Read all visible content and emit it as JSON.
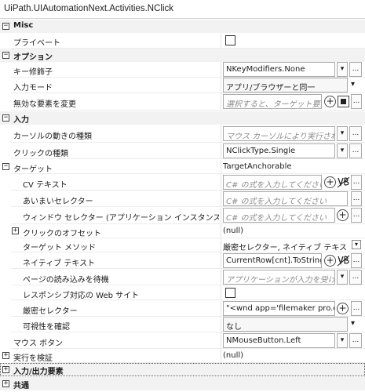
{
  "window": {
    "title": "UiPath.UIAutomationNext.Activities.NClick"
  },
  "categories": {
    "misc": "Misc",
    "options": "オプション",
    "input": "入力",
    "io_elements": "入力/出力要素",
    "common": "共通"
  },
  "expanders": {
    "minus": "⊟",
    "plus": "⊞"
  },
  "properties": {
    "private": {
      "label": "プライベート",
      "checked": false
    },
    "key_modifiers": {
      "label": "キー修飾子",
      "value": "NKeyModifiers.None"
    },
    "input_mode": {
      "label": "入力モード",
      "value": "アプリ/ブラウザーと同一"
    },
    "change_disabled": {
      "label": "無効な要素を変更",
      "value": "選択すると、ターゲット要素が"
    },
    "cursor_motion": {
      "label": "カーソルの動きの種類",
      "value": "マウス カーソルにより実行される動"
    },
    "click_type": {
      "label": "クリックの種類",
      "value": "NClickType.Single"
    },
    "target": {
      "label": "ターゲット",
      "value": "TargetAnchorable"
    },
    "cv_text": {
      "label": "CV テキスト",
      "placeholder": "C# の式を入力してください"
    },
    "fuzzy_selector": {
      "label": "あいまいセレクター",
      "placeholder": "C# の式を入力してください"
    },
    "window_selector": {
      "label": "ウィンドウ セレクター (アプリケーション インスタンス)",
      "placeholder": "C# の式を入力してください"
    },
    "click_offset": {
      "label": "クリックのオフセット",
      "value": "(null)"
    },
    "target_method": {
      "label": "ターゲット メソッド",
      "value": "厳密セレクター, ネイティブ テキスト"
    },
    "native_text": {
      "label": "ネイティブ テキスト",
      "value": "CurrentRow[cnt].ToString()"
    },
    "wait_page_load": {
      "label": "ページの読み込みを待機",
      "value": "アプリケーションが入力を受け入れ"
    },
    "responsive_web": {
      "label": "レスポンシブ対応の Web サイト",
      "checked": false
    },
    "strict_selector": {
      "label": "厳密セレクター",
      "value": "\"<wnd app='filemaker pro.exe"
    },
    "verify_visibility": {
      "label": "可視性を確認",
      "value": "なし"
    },
    "mouse_button": {
      "label": "マウス ボタン",
      "value": "NMouseButton.Left"
    },
    "verify_execution": {
      "label": "実行を検証",
      "value": "(null)"
    }
  },
  "buttons": {
    "dropdown": "▾",
    "ellipsis": "...",
    "add": "+"
  },
  "icons": {
    "plus-circle": "plus-circle-icon",
    "vb-expression": "vb-expression-icon",
    "expression-editor": "expression-editor-icon"
  }
}
